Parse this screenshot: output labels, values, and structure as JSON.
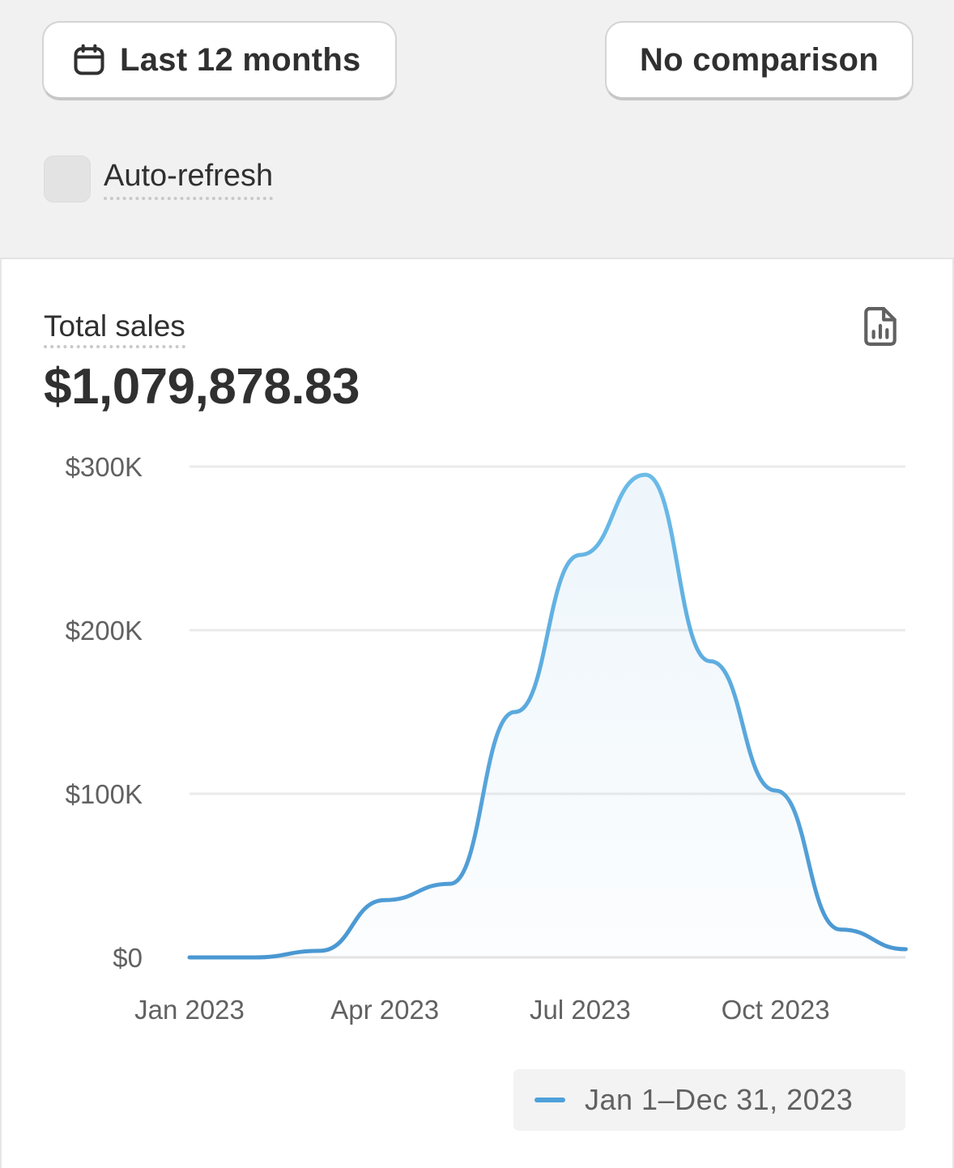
{
  "toolbar": {
    "date_range_label": "Last 12 months",
    "comparison_label": "No comparison",
    "calendar_icon": "calendar-icon"
  },
  "auto_refresh": {
    "label": "Auto-refresh",
    "checked": false
  },
  "card": {
    "metric_label": "Total sales",
    "metric_value": "$1,079,878.83",
    "report_icon": "file-chart-icon"
  },
  "legend": {
    "label": "Jan 1–Dec 31, 2023",
    "color": "#4ea0da"
  },
  "chart_data": {
    "type": "area",
    "title": "",
    "xlabel": "",
    "ylabel": "",
    "x": [
      "2023-01",
      "2023-02",
      "2023-03",
      "2023-04",
      "2023-05",
      "2023-06",
      "2023-07",
      "2023-08",
      "2023-09",
      "2023-10",
      "2023-11",
      "2023-12"
    ],
    "x_tick_labels": [
      "Jan 2023",
      "Apr 2023",
      "Jul 2023",
      "Oct 2023"
    ],
    "y_tick_labels": [
      "$0",
      "$100K",
      "$200K",
      "$300K"
    ],
    "y_ticks": [
      0,
      100000,
      200000,
      300000
    ],
    "ylim": [
      0,
      300000
    ],
    "grid": true,
    "legend_position": "bottom-right",
    "series": [
      {
        "name": "Jan 1–Dec 31, 2023",
        "color": "#4ea0da",
        "values": [
          0,
          0,
          4000,
          35000,
          45000,
          150000,
          246000,
          295000,
          181000,
          102000,
          17000,
          5000
        ]
      }
    ]
  }
}
